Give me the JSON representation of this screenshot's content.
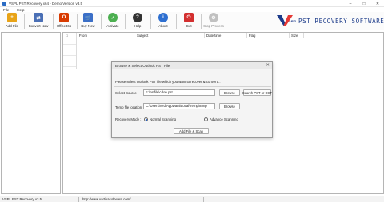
{
  "window": {
    "title": "VSPL PST Recovery x64 - Demo Version v3.5"
  },
  "menu": {
    "items": [
      "File",
      "Help"
    ]
  },
  "toolbar": {
    "buttons": [
      {
        "label": "Add File",
        "icon": "add-file-icon",
        "color": "#e8a317"
      },
      {
        "label": "Convert Now",
        "icon": "convert-icon",
        "color": "#4a6fb5"
      },
      {
        "label": "Office365",
        "icon": "office365-icon",
        "color": "#d83b01"
      },
      {
        "label": "Buy Now",
        "icon": "cart-icon",
        "color": "#3b6fc7"
      },
      {
        "label": "Activate",
        "icon": "check-icon",
        "color": "#4caf50"
      },
      {
        "label": "Help",
        "icon": "help-icon",
        "color": "#333333"
      },
      {
        "label": "About",
        "icon": "info-icon",
        "color": "#2d6fd0"
      },
      {
        "label": "Exit",
        "icon": "exit-icon",
        "color": "#d32f2f"
      },
      {
        "label": "Stop Process",
        "icon": "gear-icon",
        "color": "#9a9a9a"
      }
    ]
  },
  "logo": {
    "text": "PST RECOVERY SOFTWARE"
  },
  "grid": {
    "columns": [
      "From",
      "Subject",
      "Date/time",
      "Flag",
      "Size"
    ]
  },
  "dialog": {
    "title": "Browse & Select Outlook PST File",
    "instruction": "Please select Outlook PST file which you want to recover & convert...",
    "source_label": "Select Source",
    "source_value": "F:\\pstfile\\cdon.pst",
    "browse_label": "Browse",
    "search_label": "Search PST or OST",
    "temp_label": "Temp file location",
    "temp_value": "C:\\Users\\ved\\AppData\\Local\\Temp\\temp",
    "browse2_label": "Browse",
    "mode_label": "Recovery Mode :",
    "normal_label": "Normal Scanning",
    "advance_label": "Advance Scanning",
    "scan_button": "Add File & Scan"
  },
  "status": {
    "app": "VSPL PST Recovery v3.5",
    "url": "http://www.vartikasoftware.com/"
  }
}
